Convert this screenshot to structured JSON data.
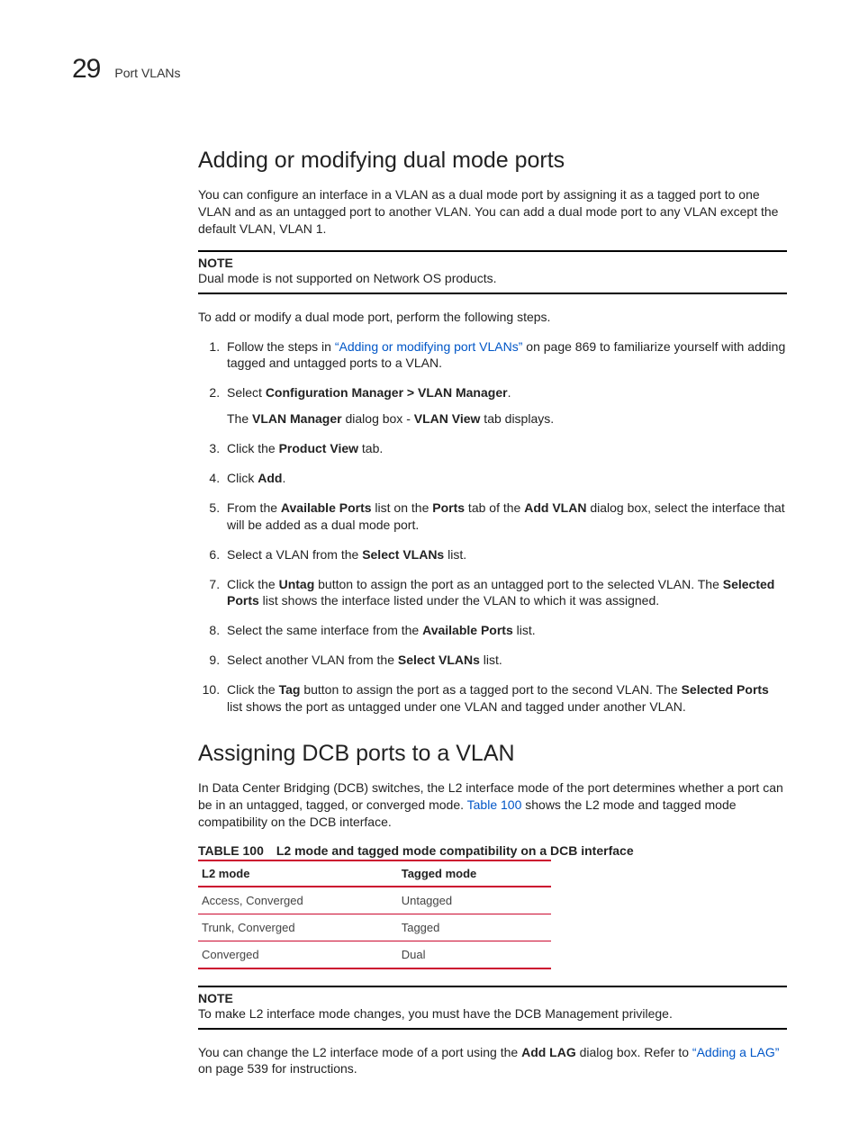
{
  "header": {
    "chapter_number": "29",
    "running_head": "Port VLANs"
  },
  "section1": {
    "title": "Adding or modifying dual mode ports",
    "intro": "You can configure an interface in a VLAN as a dual mode port by assigning it as a tagged port to one VLAN and as an untagged port to another VLAN. You can add a dual mode port to any VLAN except the default VLAN, VLAN 1.",
    "note_label": "NOTE",
    "note_text": "Dual mode is not supported on Network OS products.",
    "lead_in": "To add or modify a dual mode port, perform the following steps.",
    "steps": {
      "s1_a": "Follow the steps in ",
      "s1_link": "“Adding or modifying port VLANs”",
      "s1_b": " on page 869 to familiarize yourself with adding tagged and untagged ports to a VLAN.",
      "s2_a": "Select ",
      "s2_bold": "Configuration Manager > VLAN Manager",
      "s2_b": ".",
      "s2_sub_a": "The ",
      "s2_sub_bold1": "VLAN Manager",
      "s2_sub_mid": " dialog box - ",
      "s2_sub_bold2": "VLAN View",
      "s2_sub_b": " tab displays.",
      "s3_a": "Click the ",
      "s3_bold": "Product View",
      "s3_b": " tab.",
      "s4_a": "Click ",
      "s4_bold": "Add",
      "s4_b": ".",
      "s5_a": "From the ",
      "s5_bold1": "Available Ports",
      "s5_mid1": " list on the ",
      "s5_bold2": "Ports",
      "s5_mid2": " tab of the ",
      "s5_bold3": "Add VLAN",
      "s5_b": " dialog box, select the interface that will be added as a dual mode port.",
      "s6_a": "Select a VLAN from the ",
      "s6_bold": "Select VLANs",
      "s6_b": " list.",
      "s7_a": "Click the ",
      "s7_bold1": "Untag",
      "s7_mid": " button to assign the port as an untagged port to the selected VLAN. The ",
      "s7_bold2": "Selected Ports",
      "s7_b": " list shows the interface listed under the VLAN to which it was assigned.",
      "s8_a": "Select the same interface from the ",
      "s8_bold": "Available Ports",
      "s8_b": " list.",
      "s9_a": "Select another VLAN from the ",
      "s9_bold": "Select VLANs",
      "s9_b": " list.",
      "s10_a": "Click the ",
      "s10_bold1": "Tag",
      "s10_mid": " button to assign the port as a tagged port to the second VLAN. The ",
      "s10_bold2": "Selected Ports",
      "s10_b": " list shows the port as untagged under one VLAN and tagged under another VLAN."
    }
  },
  "section2": {
    "title": "Assigning DCB ports to a VLAN",
    "intro_a": "In Data Center Bridging (DCB) switches, the L2 interface mode of the port determines whether a port can be in an untagged, tagged, or converged mode. ",
    "intro_link": "Table 100",
    "intro_b": " shows the L2 mode and tagged mode compatibility on the DCB interface.",
    "table_label": "TABLE 100",
    "table_caption": "L2 mode and tagged mode compatibility on a DCB interface",
    "table_head_col1": "L2 mode",
    "table_head_col2": "Tagged mode",
    "table_rows": [
      {
        "c1": "Access, Converged",
        "c2": "Untagged"
      },
      {
        "c1": "Trunk, Converged",
        "c2": "Tagged"
      },
      {
        "c1": "Converged",
        "c2": "Dual"
      }
    ],
    "note_label": "NOTE",
    "note_text": "To make L2 interface mode changes, you must have the DCB Management privilege.",
    "outro_a": "You can change the L2 interface mode of a port using the ",
    "outro_bold": "Add LAG",
    "outro_mid": " dialog box. Refer to ",
    "outro_link": "“Adding a LAG”",
    "outro_b": " on page 539 for instructions."
  }
}
